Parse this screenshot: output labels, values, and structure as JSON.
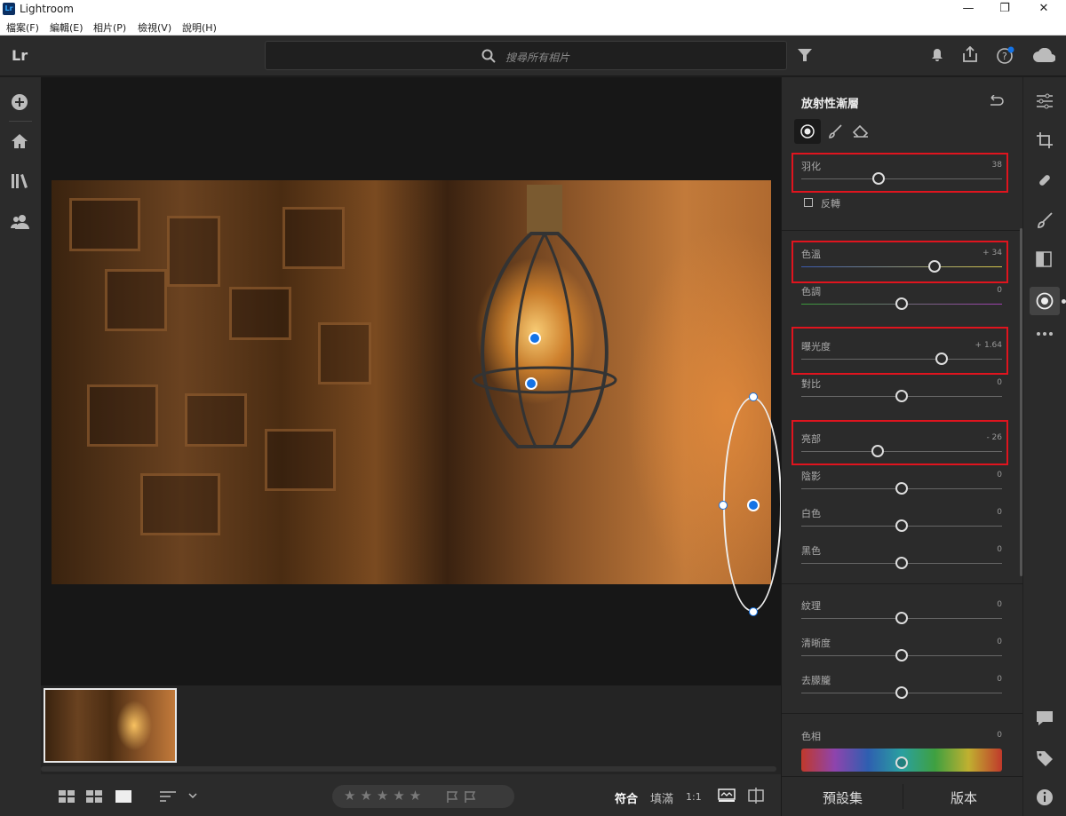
{
  "window": {
    "app_name": "Lightroom",
    "logo_text": "Lr",
    "minimize": "—",
    "maximize": "❐",
    "close": "✕"
  },
  "menu": [
    "檔案(F)",
    "編輯(E)",
    "相片(P)",
    "檢視(V)",
    "說明(H)"
  ],
  "topbar": {
    "logo": "Lr",
    "search_placeholder": "搜尋所有相片"
  },
  "panel": {
    "title": "放射性漸層",
    "feather": {
      "label": "羽化",
      "value": "38",
      "level": 38
    },
    "invert_label": "反轉",
    "sliders": [
      {
        "label": "色溫",
        "value": "+ 34",
        "level": 34,
        "highlighted": true
      },
      {
        "label": "色調",
        "value": "0",
        "level": 0
      },
      {
        "label": "曝光度",
        "value": "+ 1.64",
        "level": 1.64,
        "highlighted": true
      },
      {
        "label": "對比",
        "value": "0",
        "level": 0
      },
      {
        "label": "亮部",
        "value": "- 26",
        "level": -26,
        "highlighted": true
      },
      {
        "label": "陰影",
        "value": "0",
        "level": 0
      },
      {
        "label": "白色",
        "value": "0",
        "level": 0
      },
      {
        "label": "黑色",
        "value": "0",
        "level": 0
      },
      {
        "label": "紋理",
        "value": "0",
        "level": 0
      },
      {
        "label": "清晰度",
        "value": "0",
        "level": 0
      },
      {
        "label": "去朦朧",
        "value": "0",
        "level": 0
      }
    ],
    "hue": {
      "label": "色相",
      "value": "0"
    },
    "footer": {
      "presets": "預設集",
      "versions": "版本"
    }
  },
  "bottombar": {
    "stars": "★★★★★",
    "fit": "符合",
    "fill": "填滿",
    "one_to_one": "1:1"
  },
  "colors": {
    "accent": "#1473e6",
    "highlight_box": "#e0141e"
  }
}
